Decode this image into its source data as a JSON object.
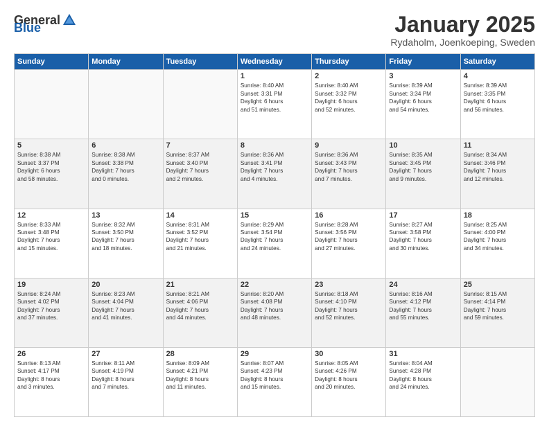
{
  "header": {
    "logo_general": "General",
    "logo_blue": "Blue",
    "month": "January 2025",
    "location": "Rydaholm, Joenkoeping, Sweden"
  },
  "days_of_week": [
    "Sunday",
    "Monday",
    "Tuesday",
    "Wednesday",
    "Thursday",
    "Friday",
    "Saturday"
  ],
  "weeks": [
    [
      {
        "day": "",
        "info": ""
      },
      {
        "day": "",
        "info": ""
      },
      {
        "day": "",
        "info": ""
      },
      {
        "day": "1",
        "info": "Sunrise: 8:40 AM\nSunset: 3:31 PM\nDaylight: 6 hours\nand 51 minutes."
      },
      {
        "day": "2",
        "info": "Sunrise: 8:40 AM\nSunset: 3:32 PM\nDaylight: 6 hours\nand 52 minutes."
      },
      {
        "day": "3",
        "info": "Sunrise: 8:39 AM\nSunset: 3:34 PM\nDaylight: 6 hours\nand 54 minutes."
      },
      {
        "day": "4",
        "info": "Sunrise: 8:39 AM\nSunset: 3:35 PM\nDaylight: 6 hours\nand 56 minutes."
      }
    ],
    [
      {
        "day": "5",
        "info": "Sunrise: 8:38 AM\nSunset: 3:37 PM\nDaylight: 6 hours\nand 58 minutes."
      },
      {
        "day": "6",
        "info": "Sunrise: 8:38 AM\nSunset: 3:38 PM\nDaylight: 7 hours\nand 0 minutes."
      },
      {
        "day": "7",
        "info": "Sunrise: 8:37 AM\nSunset: 3:40 PM\nDaylight: 7 hours\nand 2 minutes."
      },
      {
        "day": "8",
        "info": "Sunrise: 8:36 AM\nSunset: 3:41 PM\nDaylight: 7 hours\nand 4 minutes."
      },
      {
        "day": "9",
        "info": "Sunrise: 8:36 AM\nSunset: 3:43 PM\nDaylight: 7 hours\nand 7 minutes."
      },
      {
        "day": "10",
        "info": "Sunrise: 8:35 AM\nSunset: 3:45 PM\nDaylight: 7 hours\nand 9 minutes."
      },
      {
        "day": "11",
        "info": "Sunrise: 8:34 AM\nSunset: 3:46 PM\nDaylight: 7 hours\nand 12 minutes."
      }
    ],
    [
      {
        "day": "12",
        "info": "Sunrise: 8:33 AM\nSunset: 3:48 PM\nDaylight: 7 hours\nand 15 minutes."
      },
      {
        "day": "13",
        "info": "Sunrise: 8:32 AM\nSunset: 3:50 PM\nDaylight: 7 hours\nand 18 minutes."
      },
      {
        "day": "14",
        "info": "Sunrise: 8:31 AM\nSunset: 3:52 PM\nDaylight: 7 hours\nand 21 minutes."
      },
      {
        "day": "15",
        "info": "Sunrise: 8:29 AM\nSunset: 3:54 PM\nDaylight: 7 hours\nand 24 minutes."
      },
      {
        "day": "16",
        "info": "Sunrise: 8:28 AM\nSunset: 3:56 PM\nDaylight: 7 hours\nand 27 minutes."
      },
      {
        "day": "17",
        "info": "Sunrise: 8:27 AM\nSunset: 3:58 PM\nDaylight: 7 hours\nand 30 minutes."
      },
      {
        "day": "18",
        "info": "Sunrise: 8:25 AM\nSunset: 4:00 PM\nDaylight: 7 hours\nand 34 minutes."
      }
    ],
    [
      {
        "day": "19",
        "info": "Sunrise: 8:24 AM\nSunset: 4:02 PM\nDaylight: 7 hours\nand 37 minutes."
      },
      {
        "day": "20",
        "info": "Sunrise: 8:23 AM\nSunset: 4:04 PM\nDaylight: 7 hours\nand 41 minutes."
      },
      {
        "day": "21",
        "info": "Sunrise: 8:21 AM\nSunset: 4:06 PM\nDaylight: 7 hours\nand 44 minutes."
      },
      {
        "day": "22",
        "info": "Sunrise: 8:20 AM\nSunset: 4:08 PM\nDaylight: 7 hours\nand 48 minutes."
      },
      {
        "day": "23",
        "info": "Sunrise: 8:18 AM\nSunset: 4:10 PM\nDaylight: 7 hours\nand 52 minutes."
      },
      {
        "day": "24",
        "info": "Sunrise: 8:16 AM\nSunset: 4:12 PM\nDaylight: 7 hours\nand 55 minutes."
      },
      {
        "day": "25",
        "info": "Sunrise: 8:15 AM\nSunset: 4:14 PM\nDaylight: 7 hours\nand 59 minutes."
      }
    ],
    [
      {
        "day": "26",
        "info": "Sunrise: 8:13 AM\nSunset: 4:17 PM\nDaylight: 8 hours\nand 3 minutes."
      },
      {
        "day": "27",
        "info": "Sunrise: 8:11 AM\nSunset: 4:19 PM\nDaylight: 8 hours\nand 7 minutes."
      },
      {
        "day": "28",
        "info": "Sunrise: 8:09 AM\nSunset: 4:21 PM\nDaylight: 8 hours\nand 11 minutes."
      },
      {
        "day": "29",
        "info": "Sunrise: 8:07 AM\nSunset: 4:23 PM\nDaylight: 8 hours\nand 15 minutes."
      },
      {
        "day": "30",
        "info": "Sunrise: 8:05 AM\nSunset: 4:26 PM\nDaylight: 8 hours\nand 20 minutes."
      },
      {
        "day": "31",
        "info": "Sunrise: 8:04 AM\nSunset: 4:28 PM\nDaylight: 8 hours\nand 24 minutes."
      },
      {
        "day": "",
        "info": ""
      }
    ]
  ]
}
